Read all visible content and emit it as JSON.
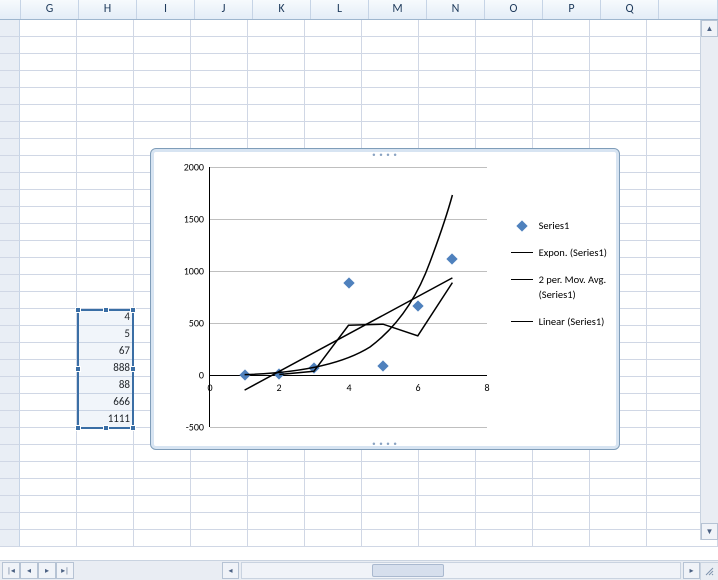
{
  "columns": [
    "G",
    "H",
    "I",
    "J",
    "K",
    "L",
    "M",
    "N",
    "O",
    "P",
    "Q"
  ],
  "cell_range": {
    "values": [
      4,
      5,
      67,
      888,
      88,
      666,
      1111
    ]
  },
  "legend": {
    "series": "Series1",
    "expon": "Expon. (Series1)",
    "movavg_l1": "2 per. Mov. Avg.",
    "movavg_l2": "(Series1)",
    "linear": "Linear (Series1)"
  },
  "chart_data": {
    "type": "scatter",
    "x": [
      1,
      2,
      3,
      4,
      5,
      6,
      7
    ],
    "series": [
      {
        "name": "Series1",
        "values": [
          4,
          5,
          67,
          888,
          88,
          666,
          1111
        ]
      }
    ],
    "trendlines": [
      {
        "name": "Expon. (Series1)",
        "type": "exponential"
      },
      {
        "name": "2 per. Mov. Avg. (Series1)",
        "type": "moving_average",
        "period": 2
      },
      {
        "name": "Linear (Series1)",
        "type": "linear"
      }
    ],
    "xlim": [
      0,
      8
    ],
    "ylim": [
      -500,
      2000
    ],
    "xticks": [
      0,
      2,
      4,
      6,
      8
    ],
    "yticks": [
      -500,
      0,
      500,
      1000,
      1500,
      2000
    ],
    "xlabel": "",
    "ylabel": "",
    "title": ""
  },
  "axis_y_labels": {
    "m500": "-500",
    "0": "0",
    "500": "500",
    "1000": "1000",
    "1500": "1500",
    "2000": "2000"
  },
  "axis_x_labels": {
    "0": "0",
    "2": "2",
    "4": "4",
    "6": "6",
    "8": "8"
  }
}
